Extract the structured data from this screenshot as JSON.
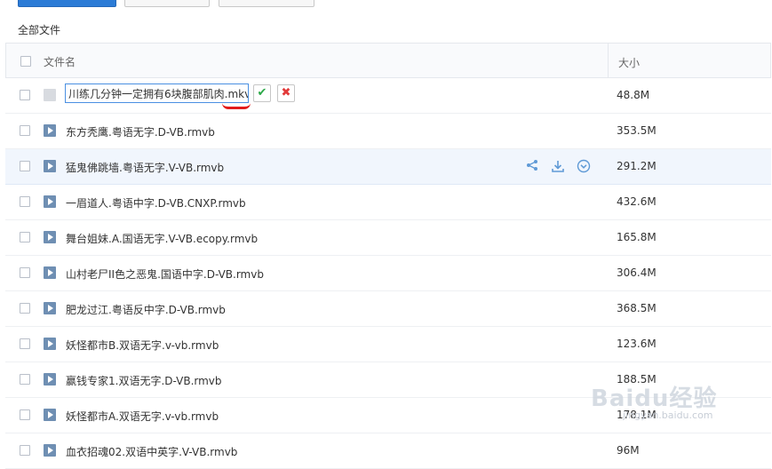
{
  "toolbar": {
    "buttons": [
      "upload-button",
      "new-folder-button",
      "offline-download-button"
    ]
  },
  "breadcrumb": "全部文件",
  "columns": {
    "name": "文件名",
    "size": "大小"
  },
  "editing": {
    "value": "川练几分钟一定拥有6块腹部肌肉.mkv",
    "size": "48.8M",
    "confirm_icon": "✔",
    "cancel_icon": "✖"
  },
  "files": [
    {
      "name": "东方秃鹰.粤语无字.D-VB.rmvb",
      "size": "353.5M"
    },
    {
      "name": "猛鬼佛跳墙.粤语无字.V-VB.rmvb",
      "size": "291.2M"
    },
    {
      "name": "一眉道人.粤语中字.D-VB.CNXP.rmvb",
      "size": "432.6M"
    },
    {
      "name": "舞台姐妹.A.国语无字.V-VB.ecopy.rmvb",
      "size": "165.8M"
    },
    {
      "name": "山村老尸II色之恶鬼.国语中字.D-VB.rmvb",
      "size": "306.4M"
    },
    {
      "name": "肥龙过江.粤语反中字.D-VB.rmvb",
      "size": "368.5M"
    },
    {
      "name": "妖怪都市B.双语无字.v-vb.rmvb",
      "size": "123.6M"
    },
    {
      "name": "赢钱专家1.双语无字.D-VB.rmvb",
      "size": "188.5M"
    },
    {
      "name": "妖怪都市A.双语无字.v-vb.rmvb",
      "size": "178.1M"
    },
    {
      "name": "血衣招魂02.双语中英字.V-VB.rmvb",
      "size": "96M"
    }
  ],
  "row_actions": {
    "share_icon": "share-icon",
    "download_icon": "download-icon",
    "more_icon": "more-icon"
  },
  "watermark": {
    "main": "Baidu经验",
    "sub": "jingyan.baidu.com"
  }
}
